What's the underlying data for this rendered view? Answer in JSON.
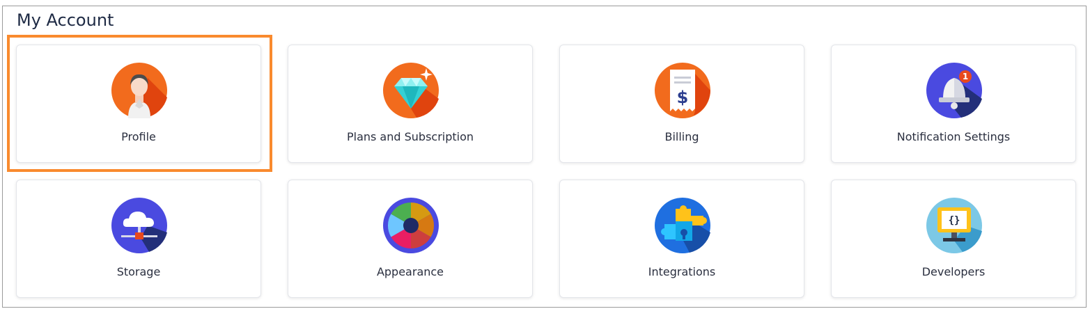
{
  "page": {
    "title": "My Account",
    "selected_card": "Profile"
  },
  "cards": [
    {
      "label": "Profile",
      "icon": "profile-icon",
      "color": "#f26b1d"
    },
    {
      "label": "Plans and Subscription",
      "icon": "diamond-icon",
      "color": "#f26b1d"
    },
    {
      "label": "Billing",
      "icon": "receipt-dollar-icon",
      "color": "#f26b1d"
    },
    {
      "label": "Notification Settings",
      "icon": "bell-icon",
      "color": "#4a4ae0"
    },
    {
      "label": "Storage",
      "icon": "cloud-storage-icon",
      "color": "#4a4ae0"
    },
    {
      "label": "Appearance",
      "icon": "color-wheel-icon",
      "color": "#4a4ae0"
    },
    {
      "label": "Integrations",
      "icon": "puzzle-icon",
      "color": "#1f6fe0"
    },
    {
      "label": "Developers",
      "icon": "code-monitor-icon",
      "color": "#7cc8e6"
    }
  ],
  "notification_badge": "1",
  "colors": {
    "accent": "#f98a2e",
    "title_text": "#1e2a44"
  }
}
